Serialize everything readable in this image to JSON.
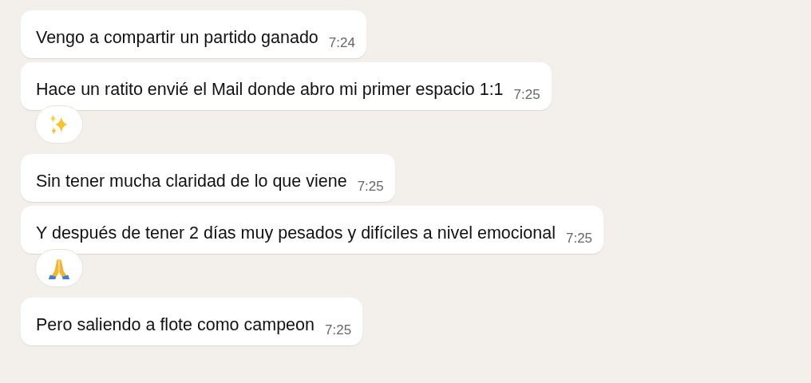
{
  "messages": [
    {
      "text": "Vengo a compartir un partido ganado",
      "time": "7:24"
    },
    {
      "text": "Hace un ratito envié el Mail donde abro mi primer espacio 1:1",
      "time": "7:25",
      "reaction": {
        "kind": "sparkles"
      }
    },
    {
      "text": "Sin tener mucha claridad de lo que viene",
      "time": "7:25"
    },
    {
      "text": "Y después de tener 2 días muy pesados y difíciles a nivel emocional",
      "time": "7:25",
      "reaction": {
        "kind": "pray"
      }
    },
    {
      "text": "Pero saliendo a flote como campeon",
      "time": "7:25"
    }
  ]
}
